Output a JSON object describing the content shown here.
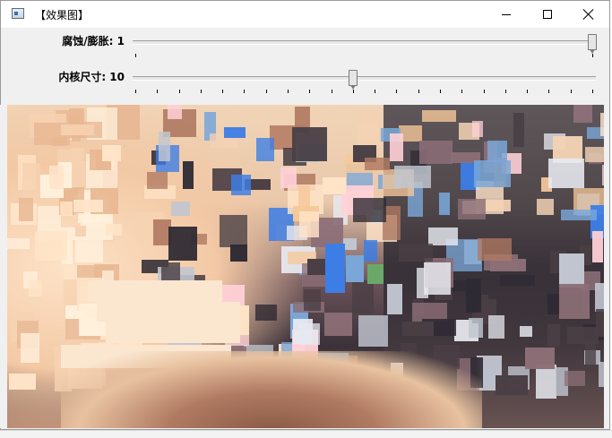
{
  "window": {
    "title": "【效果图】",
    "icon": "app-window-icon",
    "controls": [
      "minimize-icon",
      "maximize-icon",
      "close-icon"
    ]
  },
  "trackbars": [
    {
      "label": "腐蚀/膨胀: 1",
      "value": 1,
      "max": 1,
      "tick_count": 2
    },
    {
      "label": "内核尺寸: 10",
      "value": 10,
      "max": 21,
      "tick_count": 22
    }
  ],
  "image": {
    "description_kind": "mosaic-filtered-photo",
    "palette": [
      "#f3d2b4",
      "#ffe4c8",
      "#4a3f44",
      "#2e2a33",
      "#e7e9f0",
      "#7aa7d8",
      "#3d7ee6",
      "#b07a62",
      "#f6c89a",
      "#8c6e77",
      "#ffd1d8",
      "#c1c6d0"
    ]
  }
}
